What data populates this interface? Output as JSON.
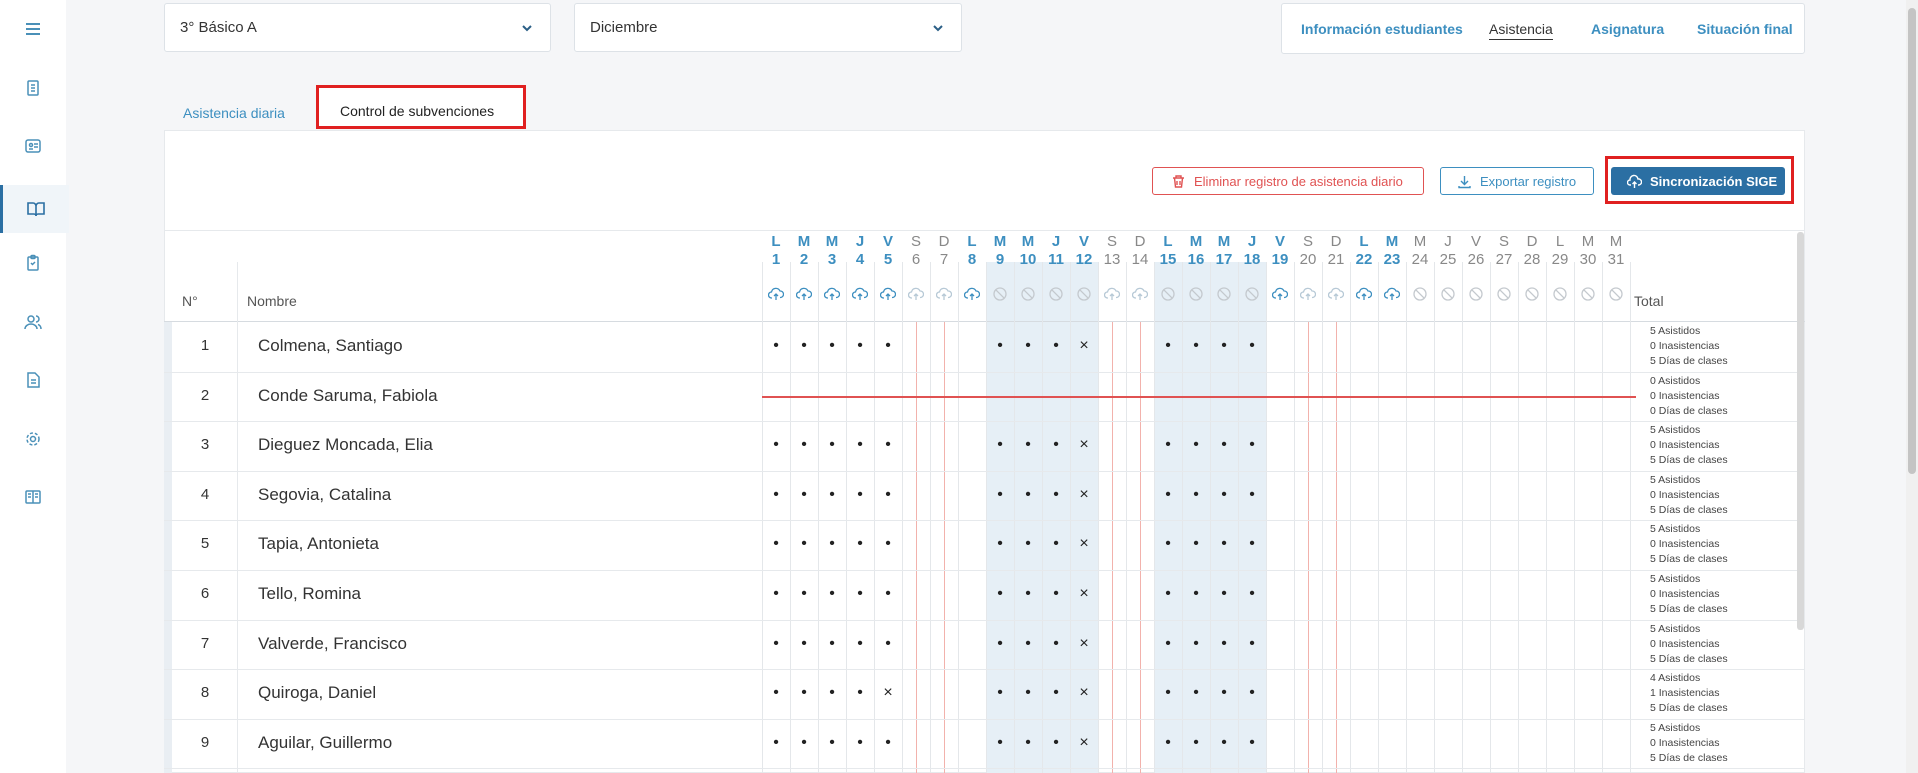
{
  "sidebar": {
    "items": [
      {
        "icon": "menu-icon"
      },
      {
        "icon": "clipboard-icon"
      },
      {
        "icon": "id-card-icon"
      },
      {
        "icon": "book-open-icon"
      },
      {
        "icon": "clipboard-check-icon"
      },
      {
        "icon": "users-icon"
      },
      {
        "icon": "document-icon"
      },
      {
        "icon": "gear-icon"
      },
      {
        "icon": "book-icon"
      }
    ]
  },
  "filters": {
    "course": "3° Básico A",
    "month": "Diciembre"
  },
  "topnav": {
    "items": [
      "Información estudiantes",
      "Asistencia",
      "Asignatura",
      "Situación final"
    ],
    "active": "Asistencia"
  },
  "tabs": {
    "daily": "Asistencia diaria",
    "subsidy": "Control de subvenciones"
  },
  "actions": {
    "delete": "Eliminar registro de asistencia diario",
    "export": "Exportar registro",
    "sync": "Sincronización SIGE"
  },
  "colors": {
    "accent": "#3d8fc0",
    "primary_button": "#2b6fa3",
    "danger": "#e05252",
    "highlight": "#e02020",
    "week_bg": "#e6eff6"
  },
  "table": {
    "col_num": "N°",
    "col_name": "Nombre",
    "col_total": "Total",
    "days": [
      {
        "l": "L",
        "d": "1",
        "on": true,
        "icon": "upload"
      },
      {
        "l": "M",
        "d": "2",
        "on": true,
        "icon": "upload"
      },
      {
        "l": "M",
        "d": "3",
        "on": true,
        "icon": "upload"
      },
      {
        "l": "J",
        "d": "4",
        "on": true,
        "icon": "upload"
      },
      {
        "l": "V",
        "d": "5",
        "on": true,
        "icon": "upload"
      },
      {
        "l": "S",
        "d": "6",
        "on": false,
        "icon": "upload"
      },
      {
        "l": "D",
        "d": "7",
        "on": false,
        "icon": "upload"
      },
      {
        "l": "L",
        "d": "8",
        "on": true,
        "icon": "upload"
      },
      {
        "l": "M",
        "d": "9",
        "on": true,
        "icon": "blocked"
      },
      {
        "l": "M",
        "d": "10",
        "on": true,
        "icon": "blocked"
      },
      {
        "l": "J",
        "d": "11",
        "on": true,
        "icon": "blocked"
      },
      {
        "l": "V",
        "d": "12",
        "on": true,
        "icon": "blocked"
      },
      {
        "l": "S",
        "d": "13",
        "on": false,
        "icon": "upload"
      },
      {
        "l": "D",
        "d": "14",
        "on": false,
        "icon": "upload"
      },
      {
        "l": "L",
        "d": "15",
        "on": true,
        "icon": "blocked"
      },
      {
        "l": "M",
        "d": "16",
        "on": true,
        "icon": "blocked"
      },
      {
        "l": "M",
        "d": "17",
        "on": true,
        "icon": "blocked"
      },
      {
        "l": "J",
        "d": "18",
        "on": true,
        "icon": "blocked"
      },
      {
        "l": "V",
        "d": "19",
        "on": true,
        "icon": "upload"
      },
      {
        "l": "S",
        "d": "20",
        "on": false,
        "icon": "upload"
      },
      {
        "l": "D",
        "d": "21",
        "on": false,
        "icon": "upload"
      },
      {
        "l": "L",
        "d": "22",
        "on": true,
        "icon": "upload"
      },
      {
        "l": "M",
        "d": "23",
        "on": true,
        "icon": "upload"
      },
      {
        "l": "M",
        "d": "24",
        "on": false,
        "icon": "blocked"
      },
      {
        "l": "J",
        "d": "25",
        "on": false,
        "icon": "blocked"
      },
      {
        "l": "V",
        "d": "26",
        "on": false,
        "icon": "blocked"
      },
      {
        "l": "S",
        "d": "27",
        "on": false,
        "icon": "blocked"
      },
      {
        "l": "D",
        "d": "28",
        "on": false,
        "icon": "blocked"
      },
      {
        "l": "L",
        "d": "29",
        "on": false,
        "icon": "blocked"
      },
      {
        "l": "M",
        "d": "30",
        "on": false,
        "icon": "blocked"
      },
      {
        "l": "M",
        "d": "31",
        "on": false,
        "icon": "blocked"
      }
    ],
    "rows": [
      {
        "num": "1",
        "name": "Colmena, Santiago",
        "marks": [
          "•",
          "•",
          "•",
          "•",
          "•",
          "",
          "",
          "",
          "•",
          "•",
          "•",
          "×",
          "",
          "",
          "•",
          "•",
          "•",
          "•"
        ],
        "totals": [
          "5 Asistidos",
          "0 Inasistencias",
          "5 Días de clases"
        ]
      },
      {
        "num": "2",
        "name": "Conde Saruma, Fabiola",
        "marks": [],
        "struck": true,
        "totals": [
          "0 Asistidos",
          "0 Inasistencias",
          "0 Días de clases"
        ]
      },
      {
        "num": "3",
        "name": "Dieguez Moncada, Elia",
        "marks": [
          "•",
          "•",
          "•",
          "•",
          "•",
          "",
          "",
          "",
          "•",
          "•",
          "•",
          "×",
          "",
          "",
          "•",
          "•",
          "•",
          "•"
        ],
        "totals": [
          "5 Asistidos",
          "0 Inasistencias",
          "5 Días de clases"
        ]
      },
      {
        "num": "4",
        "name": "Segovia, Catalina",
        "marks": [
          "•",
          "•",
          "•",
          "•",
          "•",
          "",
          "",
          "",
          "•",
          "•",
          "•",
          "×",
          "",
          "",
          "•",
          "•",
          "•",
          "•"
        ],
        "totals": [
          "5 Asistidos",
          "0 Inasistencias",
          "5 Días de clases"
        ]
      },
      {
        "num": "5",
        "name": "Tapia, Antonieta",
        "marks": [
          "•",
          "•",
          "•",
          "•",
          "•",
          "",
          "",
          "",
          "•",
          "•",
          "•",
          "×",
          "",
          "",
          "•",
          "•",
          "•",
          "•"
        ],
        "totals": [
          "5 Asistidos",
          "0 Inasistencias",
          "5 Días de clases"
        ]
      },
      {
        "num": "6",
        "name": "Tello, Romina",
        "marks": [
          "•",
          "•",
          "•",
          "•",
          "•",
          "",
          "",
          "",
          "•",
          "•",
          "•",
          "×",
          "",
          "",
          "•",
          "•",
          "•",
          "•"
        ],
        "totals": [
          "5 Asistidos",
          "0 Inasistencias",
          "5 Días de clases"
        ]
      },
      {
        "num": "7",
        "name": "Valverde, Francisco",
        "marks": [
          "•",
          "•",
          "•",
          "•",
          "•",
          "",
          "",
          "",
          "•",
          "•",
          "•",
          "×",
          "",
          "",
          "•",
          "•",
          "•",
          "•"
        ],
        "totals": [
          "5 Asistidos",
          "0 Inasistencias",
          "5 Días de clases"
        ]
      },
      {
        "num": "8",
        "name": "Quiroga, Daniel",
        "marks": [
          "•",
          "•",
          "•",
          "•",
          "×",
          "",
          "",
          "",
          "•",
          "•",
          "•",
          "×",
          "",
          "",
          "•",
          "•",
          "•",
          "•"
        ],
        "totals": [
          "4 Asistidos",
          "1 Inasistencias",
          "5 Días de clases"
        ]
      },
      {
        "num": "9",
        "name": "Aguilar, Guillermo",
        "marks": [
          "•",
          "•",
          "•",
          "•",
          "•",
          "",
          "",
          "",
          "•",
          "•",
          "•",
          "×",
          "",
          "",
          "•",
          "•",
          "•",
          "•"
        ],
        "totals": [
          "5 Asistidos",
          "0 Inasistencias",
          "5 Días de clases"
        ]
      }
    ]
  }
}
